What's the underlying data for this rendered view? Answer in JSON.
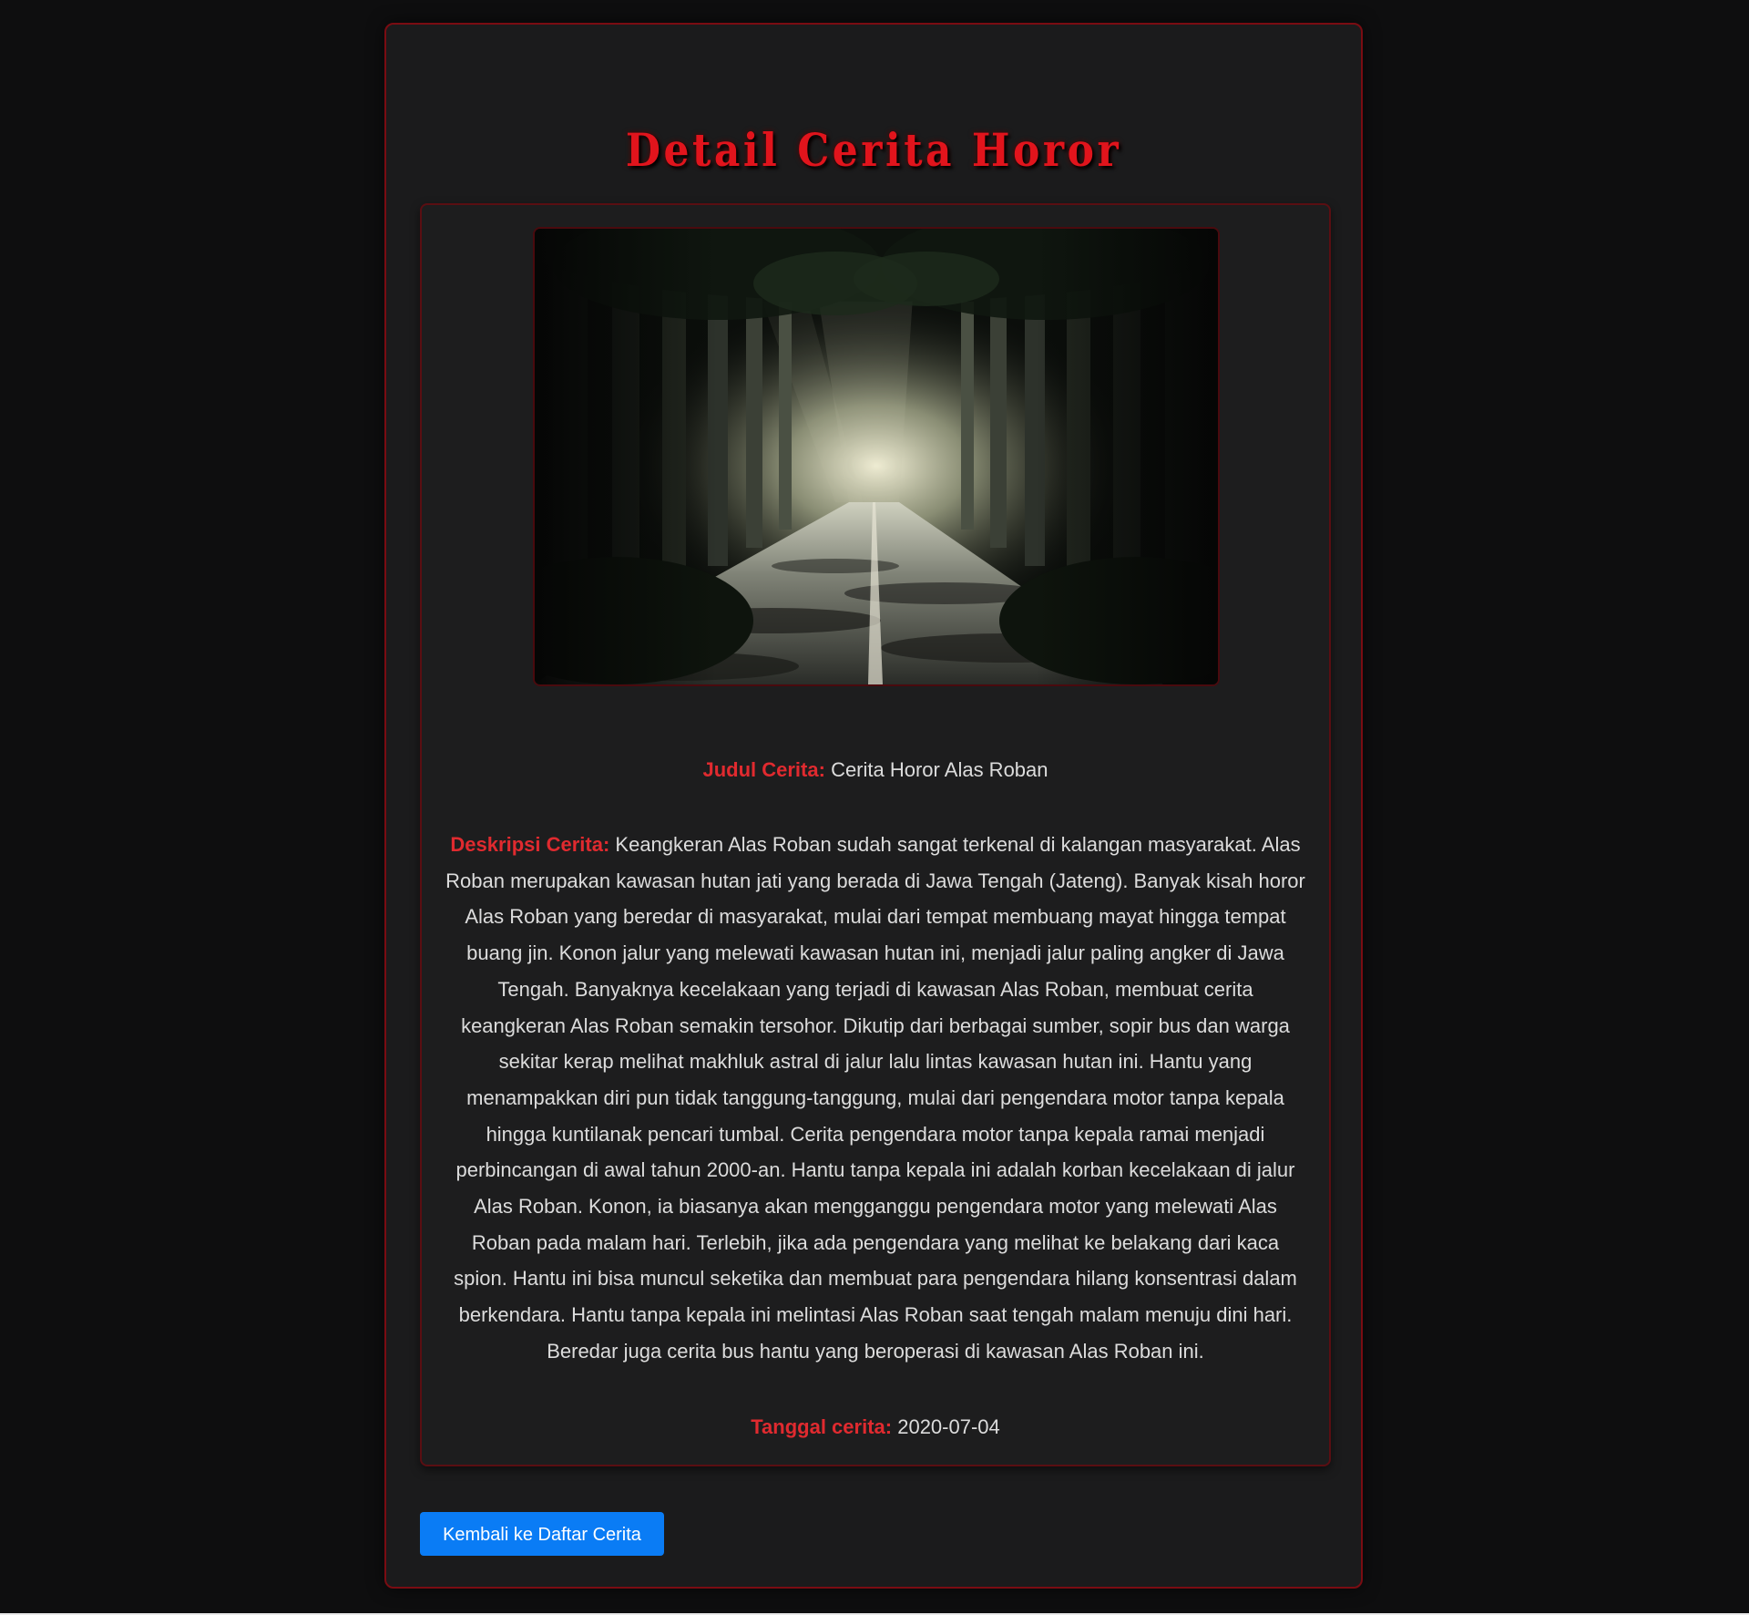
{
  "page": {
    "heading": "Detail Cerita Horor"
  },
  "story": {
    "image_alt": "dark forest road with light at the end",
    "title_label": "Judul Cerita:",
    "title_value": "Cerita Horor Alas Roban",
    "description_label": "Deskripsi Cerita:",
    "description_value": "Keangkeran Alas Roban sudah sangat terkenal di kalangan masyarakat. Alas Roban merupakan kawasan hutan jati yang berada di Jawa Tengah (Jateng). Banyak kisah horor Alas Roban yang beredar di masyarakat, mulai dari tempat membuang mayat hingga tempat buang jin. Konon jalur yang melewati kawasan hutan ini, menjadi jalur paling angker di Jawa Tengah. Banyaknya kecelakaan yang terjadi di kawasan Alas Roban, membuat cerita keangkeran Alas Roban semakin tersohor. Dikutip dari berbagai sumber, sopir bus dan warga sekitar kerap melihat makhluk astral di jalur lalu lintas kawasan hutan ini. Hantu yang menampakkan diri pun tidak tanggung-tanggung, mulai dari pengendara motor tanpa kepala hingga kuntilanak pencari tumbal. Cerita pengendara motor tanpa kepala ramai menjadi perbincangan di awal tahun 2000-an. Hantu tanpa kepala ini adalah korban kecelakaan di jalur Alas Roban. Konon, ia biasanya akan mengganggu pengendara motor yang melewati Alas Roban pada malam hari. Terlebih, jika ada pengendara yang melihat ke belakang dari kaca spion. Hantu ini bisa muncul seketika dan membuat para pengendara hilang konsentrasi dalam berkendara. Hantu tanpa kepala ini melintasi Alas Roban saat tengah malam menuju dini hari. Beredar juga cerita bus hantu yang beroperasi di kawasan Alas Roban ini.",
    "date_label": "Tanggal cerita:",
    "date_value": "2020-07-04"
  },
  "actions": {
    "back_label": "Kembali ke Daftar Cerita"
  },
  "colors": {
    "background": "#0e0e0f",
    "panel": "#1b1b1c",
    "accent_red": "#e1141c",
    "label_red": "#e02a2f",
    "button_blue": "#0a7cf5"
  }
}
